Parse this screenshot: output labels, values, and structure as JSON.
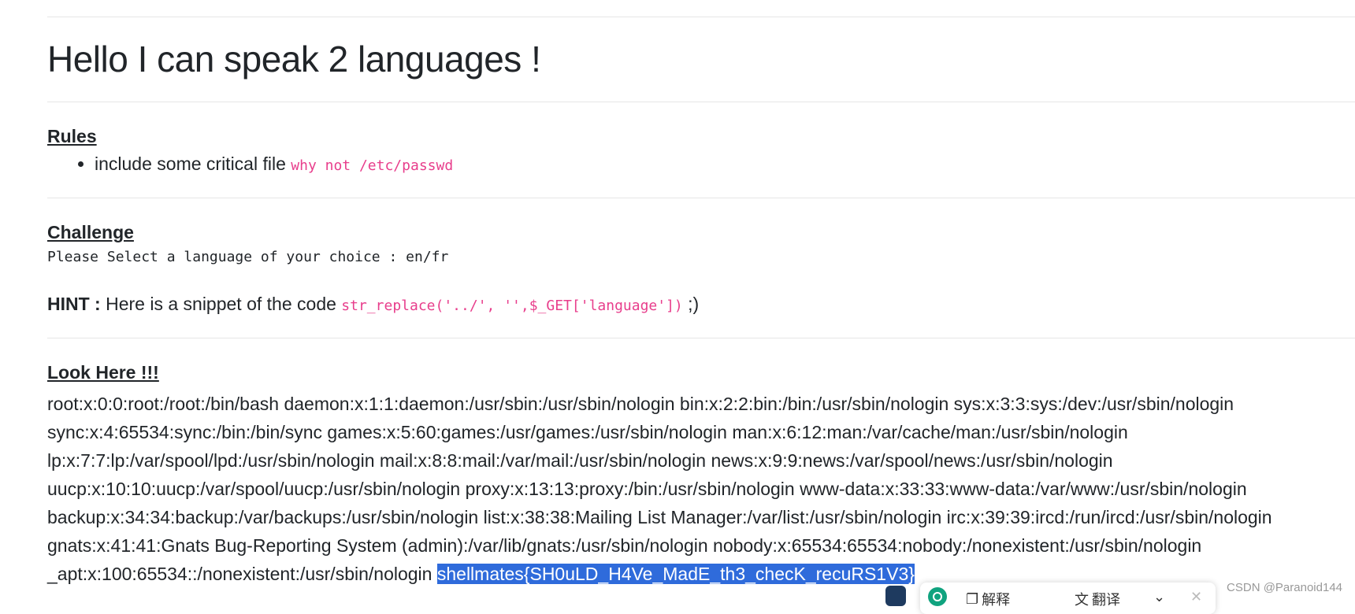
{
  "page_title": "Hello I can speak 2 languages !",
  "rules": {
    "heading": "Rules",
    "item_text": "include some critical file",
    "item_code": "why not /etc/passwd"
  },
  "challenge": {
    "heading": "Challenge",
    "text": "Please Select a language of your choice : en/fr"
  },
  "hint": {
    "label": "HINT :",
    "text": "Here is a snippet of the code",
    "code": "str_replace('../', '',$_GET['language'])",
    "suffix": ";)"
  },
  "output": {
    "heading": "Look Here !!!",
    "passwd_text": "root:x:0:0:root:/root:/bin/bash daemon:x:1:1:daemon:/usr/sbin:/usr/sbin/nologin bin:x:2:2:bin:/bin:/usr/sbin/nologin sys:x:3:3:sys:/dev:/usr/sbin/nologin sync:x:4:65534:sync:/bin:/bin/sync games:x:5:60:games:/usr/games:/usr/sbin/nologin man:x:6:12:man:/var/cache/man:/usr/sbin/nologin lp:x:7:7:lp:/var/spool/lpd:/usr/sbin/nologin mail:x:8:8:mail:/var/mail:/usr/sbin/nologin news:x:9:9:news:/var/spool/news:/usr/sbin/nologin uucp:x:10:10:uucp:/var/spool/uucp:/usr/sbin/nologin proxy:x:13:13:proxy:/bin:/usr/sbin/nologin www-data:x:33:33:www-data:/var/www:/usr/sbin/nologin backup:x:34:34:backup:/var/backups:/usr/sbin/nologin list:x:38:38:Mailing List Manager:/var/list:/usr/sbin/nologin irc:x:39:39:ircd:/run/ircd:/usr/sbin/nologin gnats:x:41:41:Gnats Bug-Reporting System (admin):/var/lib/gnats:/usr/sbin/nologin nobody:x:65534:65534:nobody:/nonexistent:/usr/sbin/nologin _apt:x:100:65534::/nonexistent:/usr/sbin/nologin",
    "flag": "shellmates{SH0uLD_H4Ve_MadE_th3_checK_recuRS1V3}"
  },
  "toolbar": {
    "explain_label": "解释",
    "translate_label": "翻译",
    "icons": [
      "ai-assistant-icon",
      "chatgpt-icon",
      "explain-icon",
      "translate-icon",
      "chevron-down-icon",
      "close-icon"
    ]
  },
  "watermark": "CSDN @Paranoid144",
  "colors": {
    "code_pink": "#e83e8c",
    "selection_blue": "#2f6bdb",
    "text": "#212529"
  }
}
